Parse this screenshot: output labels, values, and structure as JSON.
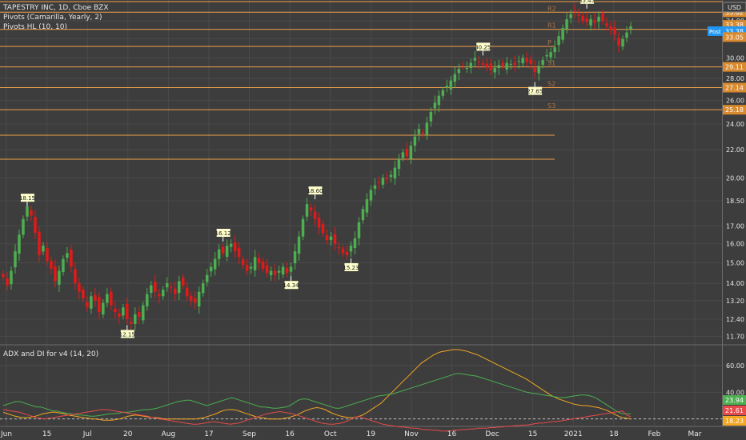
{
  "header": {
    "title": "TAPESTRY INC, 1D, Cboe BZX",
    "indicator1": "Pivots (Camarilla, Yearly, 2)",
    "indicator2": "Pivots HL (10, 10)",
    "currency": "USD"
  },
  "subpane": {
    "title": "ADX and DI for v4 (14, 20)"
  },
  "colors": {
    "background": "#3d3d3d",
    "up": "#4caf50",
    "down": "#e31919",
    "pivot_line": "#f0a04b",
    "pivot_label": "#b0764a",
    "marker_fill": "#ffffcc",
    "adx": "#f5a623",
    "di_plus": "#4caf50",
    "di_minus": "#e84a4a",
    "price_tag_blue": "#2196f3"
  },
  "chart_data": [
    {
      "type": "candlestick",
      "xlabels": [
        "Jun",
        "15",
        "Jul",
        "20",
        "Aug",
        "17",
        "Sep",
        "16",
        "Oct",
        "19",
        "Nov",
        "16",
        "Dec",
        "15",
        "2021",
        "18",
        "Feb",
        "Mar"
      ],
      "ylabels": [
        "11.70",
        "12.40",
        "13.20",
        "14.00",
        "15.00",
        "16.00",
        "17.00",
        "18.50",
        "20.00",
        "22.00",
        "24.00",
        "26.00",
        "28.00",
        "30.00",
        "32.00",
        "34.00"
      ],
      "ylim": [
        11.4,
        36.5
      ],
      "y_scale": "log",
      "price_tags": [
        {
          "label": "35.02",
          "value": 35.02
        },
        {
          "label": "33.38",
          "value": 33.55
        },
        {
          "label": "Post 33.38",
          "value": 32.85
        },
        {
          "label": "33.05",
          "value": 32.2
        },
        {
          "label": "29.11",
          "value": 29.11
        },
        {
          "label": "27.14",
          "value": 27.14
        },
        {
          "label": "25.18",
          "value": 25.18
        }
      ],
      "pivot_levels": [
        {
          "name": "R3",
          "value": 36.3
        },
        {
          "name": "R2",
          "value": 35.02
        },
        {
          "name": "R1",
          "value": 33.05
        },
        {
          "name": "P",
          "value": 31.2
        },
        {
          "name": "S1",
          "value": 29.11
        },
        {
          "name": "S2",
          "value": 27.14
        },
        {
          "name": "S3",
          "value": 25.18
        },
        {
          "name": "",
          "value": 23.1
        },
        {
          "name": "",
          "value": 21.3
        }
      ],
      "markers": [
        {
          "label": "18.15",
          "x": "Jun 8",
          "value": 18.15,
          "position": "above"
        },
        {
          "label": "12.15",
          "x": "Jul 13",
          "value": 12.15,
          "position": "below"
        },
        {
          "label": "16.12",
          "x": "Aug 13",
          "value": 16.12,
          "position": "above"
        },
        {
          "label": "14.34",
          "x": "Sep 11",
          "value": 14.34,
          "position": "below"
        },
        {
          "label": "18.60",
          "x": "Sep 16",
          "value": 18.6,
          "position": "above"
        },
        {
          "label": "15.23",
          "x": "Oct 1",
          "value": 15.23,
          "position": "below"
        },
        {
          "label": "30.25",
          "x": "Nov 27",
          "value": 30.25,
          "position": "above"
        },
        {
          "label": "27.65",
          "x": "Dec 18",
          "value": 27.65,
          "position": "below"
        },
        {
          "label": "35.45",
          "x": "Jan 13",
          "value": 35.45,
          "position": "above"
        }
      ],
      "close_series": [
        14.3,
        13.9,
        14.6,
        15.6,
        16.5,
        17.4,
        18.15,
        17.6,
        16.6,
        15.4,
        15.9,
        15.1,
        14.7,
        14.1,
        14.6,
        15.2,
        15.5,
        14.8,
        14.0,
        13.6,
        13.3,
        12.9,
        13.4,
        13.2,
        12.7,
        13.1,
        13.5,
        13.0,
        12.7,
        12.5,
        12.9,
        12.4,
        12.2,
        12.6,
        12.5,
        13.0,
        13.5,
        13.9,
        13.6,
        13.4,
        13.7,
        14.0,
        13.8,
        13.5,
        14.1,
        13.9,
        13.4,
        13.2,
        13.1,
        13.6,
        14.0,
        14.4,
        14.8,
        15.2,
        15.7,
        15.5,
        15.9,
        16.0,
        15.6,
        15.3,
        14.9,
        14.6,
        14.8,
        15.3,
        15.0,
        14.7,
        14.5,
        14.6,
        14.4,
        14.6,
        14.8,
        14.5,
        14.8,
        15.6,
        16.4,
        17.4,
        18.3,
        17.9,
        17.4,
        16.9,
        16.6,
        16.2,
        16.4,
        16.0,
        15.8,
        15.5,
        15.4,
        15.9,
        16.3,
        17.2,
        18.0,
        18.6,
        19.2,
        19.5,
        19.7,
        20.0,
        19.9,
        20.2,
        20.7,
        21.3,
        21.8,
        21.5,
        22.3,
        23.0,
        23.6,
        23.2,
        24.1,
        25.0,
        25.8,
        26.4,
        26.9,
        27.3,
        27.8,
        28.4,
        28.9,
        29.2,
        29.0,
        29.5,
        30.0,
        29.6,
        29.3,
        29.1,
        28.8,
        29.0,
        29.3,
        29.2,
        29.5,
        29.4,
        29.3,
        29.7,
        30.0,
        29.6,
        29.4,
        28.6,
        29.2,
        29.8,
        30.3,
        30.6,
        31.1,
        32.3,
        33.2,
        34.2,
        34.8,
        35.1,
        34.6,
        34.0,
        33.9,
        34.2,
        33.8,
        34.5,
        34.0,
        33.4,
        33.0,
        32.5,
        31.3,
        32.0,
        32.7,
        33.38
      ],
      "adx_panel": {
        "ylabels": [
          "20.00",
          "40.00",
          "60.00"
        ],
        "ylim": [
          15,
          75
        ],
        "threshold": 20,
        "series": [
          {
            "label": "23.94",
            "value": 23.94,
            "role": "DI+"
          },
          {
            "label": "21.61",
            "value": 21.61,
            "role": "DI-"
          },
          {
            "label": "18.23",
            "value": 18.23,
            "role": "ADX"
          }
        ],
        "adx": [
          25,
          24,
          23,
          22,
          21.5,
          21,
          21,
          21.5,
          22,
          23,
          24,
          24.5,
          25,
          25,
          24.5,
          24,
          23,
          22.5,
          22,
          21.5,
          21,
          20.5,
          20,
          20,
          19.5,
          19,
          19,
          19,
          19.5,
          20,
          21,
          22,
          22.5,
          23,
          22.5,
          22,
          21.5,
          21,
          21,
          20.5,
          20,
          20,
          20,
          20,
          20,
          20,
          20,
          20,
          20,
          20.5,
          21,
          22,
          23,
          24,
          25.5,
          26.5,
          27,
          27,
          26.5,
          25.5,
          24.5,
          23.5,
          22.5,
          21.5,
          21,
          20.5,
          20,
          20,
          20,
          20,
          20.5,
          21,
          22,
          23,
          24.5,
          26,
          27,
          28,
          28.5,
          28,
          27,
          25.5,
          24,
          23,
          22,
          21.5,
          21,
          21,
          21.5,
          22.5,
          24,
          26,
          28,
          30,
          32,
          35,
          38,
          41,
          44,
          47,
          50,
          53,
          56,
          59,
          62,
          64,
          66,
          68,
          69.5,
          70.5,
          71,
          71.5,
          72,
          72,
          71.5,
          71,
          70,
          69,
          68,
          66.5,
          65,
          63.5,
          62,
          60.5,
          59,
          57.5,
          56,
          54.5,
          53,
          51.5,
          50,
          48,
          46,
          44,
          42,
          40,
          38,
          36.5,
          35,
          34,
          33,
          32,
          31,
          30.5,
          30,
          30,
          29.5,
          29,
          28.5,
          27.5,
          26.5,
          25,
          23.5,
          22,
          21,
          20.5,
          20
        ],
        "di_plus": [
          30,
          31,
          32,
          33,
          33,
          32,
          31,
          30,
          29,
          29,
          28,
          27,
          26,
          26,
          25,
          24.5,
          24,
          23.5,
          23,
          23,
          22.5,
          22,
          22,
          22.5,
          23,
          23.5,
          24,
          24,
          24.5,
          25,
          25,
          25.5,
          26,
          26.5,
          27,
          27,
          27.5,
          28,
          29,
          30,
          31,
          32,
          33,
          33.5,
          34,
          34,
          33,
          32,
          31,
          30,
          31,
          32,
          33,
          34,
          35,
          36,
          35,
          34,
          33,
          32,
          31,
          30,
          29,
          29,
          28.5,
          28,
          28,
          28.5,
          29,
          30,
          32,
          34,
          35,
          35,
          34,
          33,
          32,
          31,
          30,
          29,
          28,
          28,
          29,
          30,
          31,
          32,
          33,
          34,
          35,
          36,
          37,
          37.5,
          38,
          38.5,
          39,
          40,
          41,
          42,
          43,
          44,
          45,
          46,
          47,
          48,
          49,
          50,
          51,
          52,
          53,
          54,
          54,
          53.5,
          53,
          52.5,
          52,
          51,
          50,
          49,
          48,
          47,
          46,
          45,
          44,
          43,
          42,
          41,
          40,
          39.5,
          39,
          38.5,
          38,
          37.5,
          37,
          36.5,
          36,
          36,
          36.5,
          37,
          37.5,
          38,
          38,
          37.5,
          36.5,
          35,
          33,
          31,
          29,
          27,
          25,
          24,
          23.9,
          23.94
        ],
        "di_minus": [
          27,
          26.5,
          26,
          25.5,
          25,
          24,
          23,
          22,
          21,
          20.5,
          20,
          20.5,
          21,
          21.5,
          22,
          22.5,
          23,
          23.5,
          24,
          24.5,
          25,
          25.5,
          26,
          26.5,
          27,
          27,
          26.5,
          26,
          25.5,
          25,
          24.5,
          24,
          23.5,
          23,
          22.5,
          22,
          21,
          20.5,
          20,
          19.5,
          19,
          18.5,
          18,
          17.5,
          17,
          16.5,
          16,
          16,
          16.5,
          17,
          17.5,
          18,
          17.5,
          17,
          16.5,
          16,
          16.5,
          17,
          18,
          19,
          20,
          21,
          22,
          23,
          24,
          24.5,
          25,
          25.5,
          25,
          24.5,
          24,
          23,
          22,
          21,
          20,
          19,
          18,
          17,
          16.5,
          16,
          16,
          16.5,
          17,
          18,
          19.5,
          21,
          22,
          21,
          20,
          19,
          18,
          17,
          16,
          15.5,
          15,
          14.5,
          14,
          14,
          13.5,
          13,
          13,
          12.5,
          12,
          12,
          11.5,
          11.5,
          11,
          11,
          11,
          11.5,
          11.5,
          12,
          12,
          12.5,
          12.5,
          13,
          13,
          13,
          13.5,
          13.5,
          14,
          14,
          14.5,
          14.5,
          15,
          15,
          15.5,
          15.5,
          16,
          16.5,
          17,
          17,
          17.5,
          18,
          18,
          18.5,
          19,
          19.5,
          20,
          20.5,
          21,
          21.5,
          22,
          22.5,
          23,
          23.5,
          24,
          24.5,
          25,
          25.5,
          26,
          23,
          21.61
        ]
      }
    }
  ]
}
